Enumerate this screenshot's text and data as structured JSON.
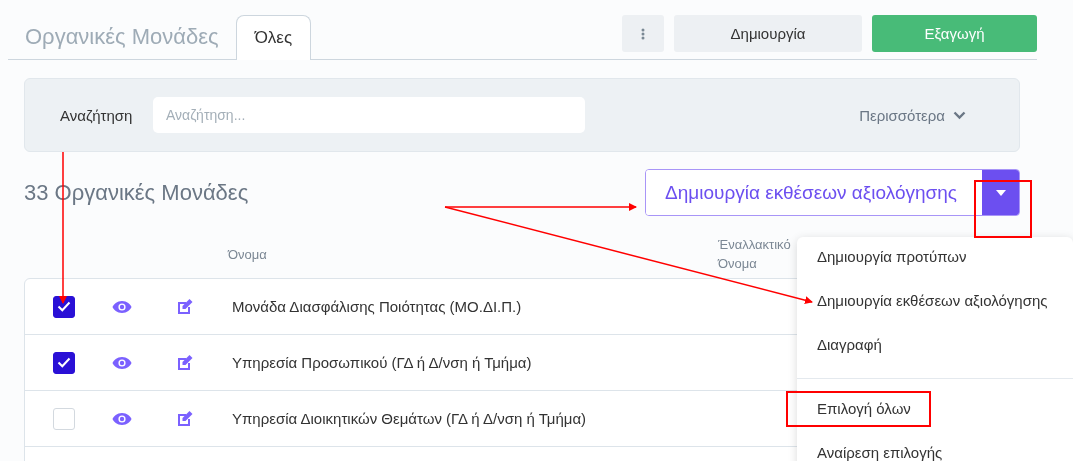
{
  "header": {
    "title": "Οργανικές Μονάδες",
    "tabs": [
      {
        "label": "Όλες",
        "selected": true
      }
    ],
    "buttons": [
      {
        "kind": "kebab"
      },
      {
        "kind": "secondary",
        "label": "Δημιουργία"
      },
      {
        "kind": "primary",
        "label": "Εξαγωγή"
      }
    ]
  },
  "search": {
    "label": "Αναζήτηση",
    "placeholder": "Αναζήτηση...",
    "more": "Περισσότερα"
  },
  "list": {
    "heading": "33 Οργανικές Μονάδες",
    "action": {
      "label": "Δημιουργία εκθέσεων αξιολόγησης",
      "expanded": true
    }
  },
  "table": {
    "columns": [
      "Όνομα",
      "Έναλλακτικό Όνομα"
    ],
    "rows": [
      {
        "checked": true,
        "name": "Μονάδα Διασφάλισης Ποιότητας (ΜΟ.ΔΙ.Π.)"
      },
      {
        "checked": true,
        "name": "Υπηρεσία Προσωπικού (ΓΔ ή Δ/νση ή Τμήμα)"
      },
      {
        "checked": false,
        "name": "Υπηρεσία Διοικητικών Θεμάτων (ΓΔ ή Δ/νση ή Τμήμα)"
      }
    ]
  },
  "menu": {
    "sections": [
      [
        "Δημιουργία προτύπων",
        "Δημιουργία εκθέσεων αξιολόγησης",
        "Διαγραφή"
      ],
      [
        "Επιλογή όλων",
        "Αναίρεση επιλογής"
      ]
    ]
  }
}
